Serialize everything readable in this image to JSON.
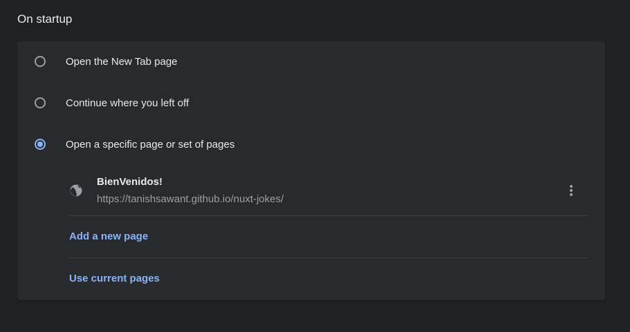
{
  "section": {
    "title": "On startup"
  },
  "startup_options": [
    {
      "label": "Open the New Tab page",
      "checked": false
    },
    {
      "label": "Continue where you left off",
      "checked": false
    },
    {
      "label": "Open a specific page or set of pages",
      "checked": true
    }
  ],
  "pages": [
    {
      "title": "BienVenidos!",
      "url": "https://tanishsawant.github.io/nuxt-jokes/",
      "icon": "globe-icon",
      "menu_icon": "more-vert-icon"
    }
  ],
  "actions": {
    "add_page": "Add a new page",
    "use_current": "Use current pages"
  },
  "colors": {
    "background": "#202124",
    "card": "#292a2d",
    "accent": "#8ab4f8",
    "text_primary": "#e8eaed",
    "text_secondary": "#9aa0a6",
    "divider": "#3c4043"
  }
}
